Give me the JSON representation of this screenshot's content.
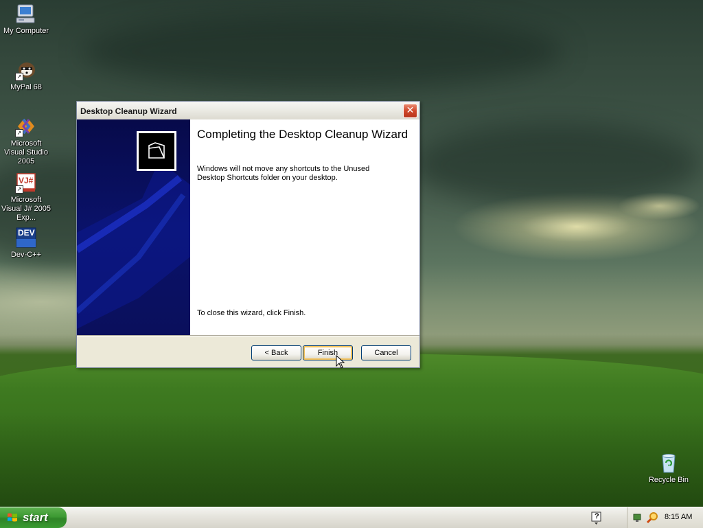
{
  "desktop": {
    "icons": [
      {
        "label": "My Computer",
        "icon": "my-computer-icon"
      },
      {
        "label": "MyPal 68",
        "icon": "mypal-icon"
      },
      {
        "label": "Microsoft Visual Studio 2005",
        "icon": "visual-studio-icon"
      },
      {
        "label": "Microsoft Visual J# 2005 Exp...",
        "icon": "visual-jsharp-icon"
      },
      {
        "label": "Dev-C++",
        "icon": "devcpp-icon"
      },
      {
        "label": "Recycle Bin",
        "icon": "recycle-bin-icon"
      }
    ],
    "devcpp_badge": "DEV",
    "jsharp_badge": "VJ#"
  },
  "wizard": {
    "title": "Desktop Cleanup Wizard",
    "close_glyph": "✕",
    "heading": "Completing the Desktop Cleanup Wizard",
    "message": "Windows will not move any shortcuts to the Unused Desktop Shortcuts folder on your desktop.",
    "footer": "To close this wizard, click Finish.",
    "buttons": {
      "back": "< Back",
      "finish": "Finish",
      "cancel": "Cancel"
    }
  },
  "taskbar": {
    "start_label": "start",
    "help_glyph": "?",
    "clock": "8:15 AM"
  },
  "colors": {
    "wizard_side": "#0a1269",
    "start_green": "#3d9a33",
    "close_red": "#d0472a"
  }
}
